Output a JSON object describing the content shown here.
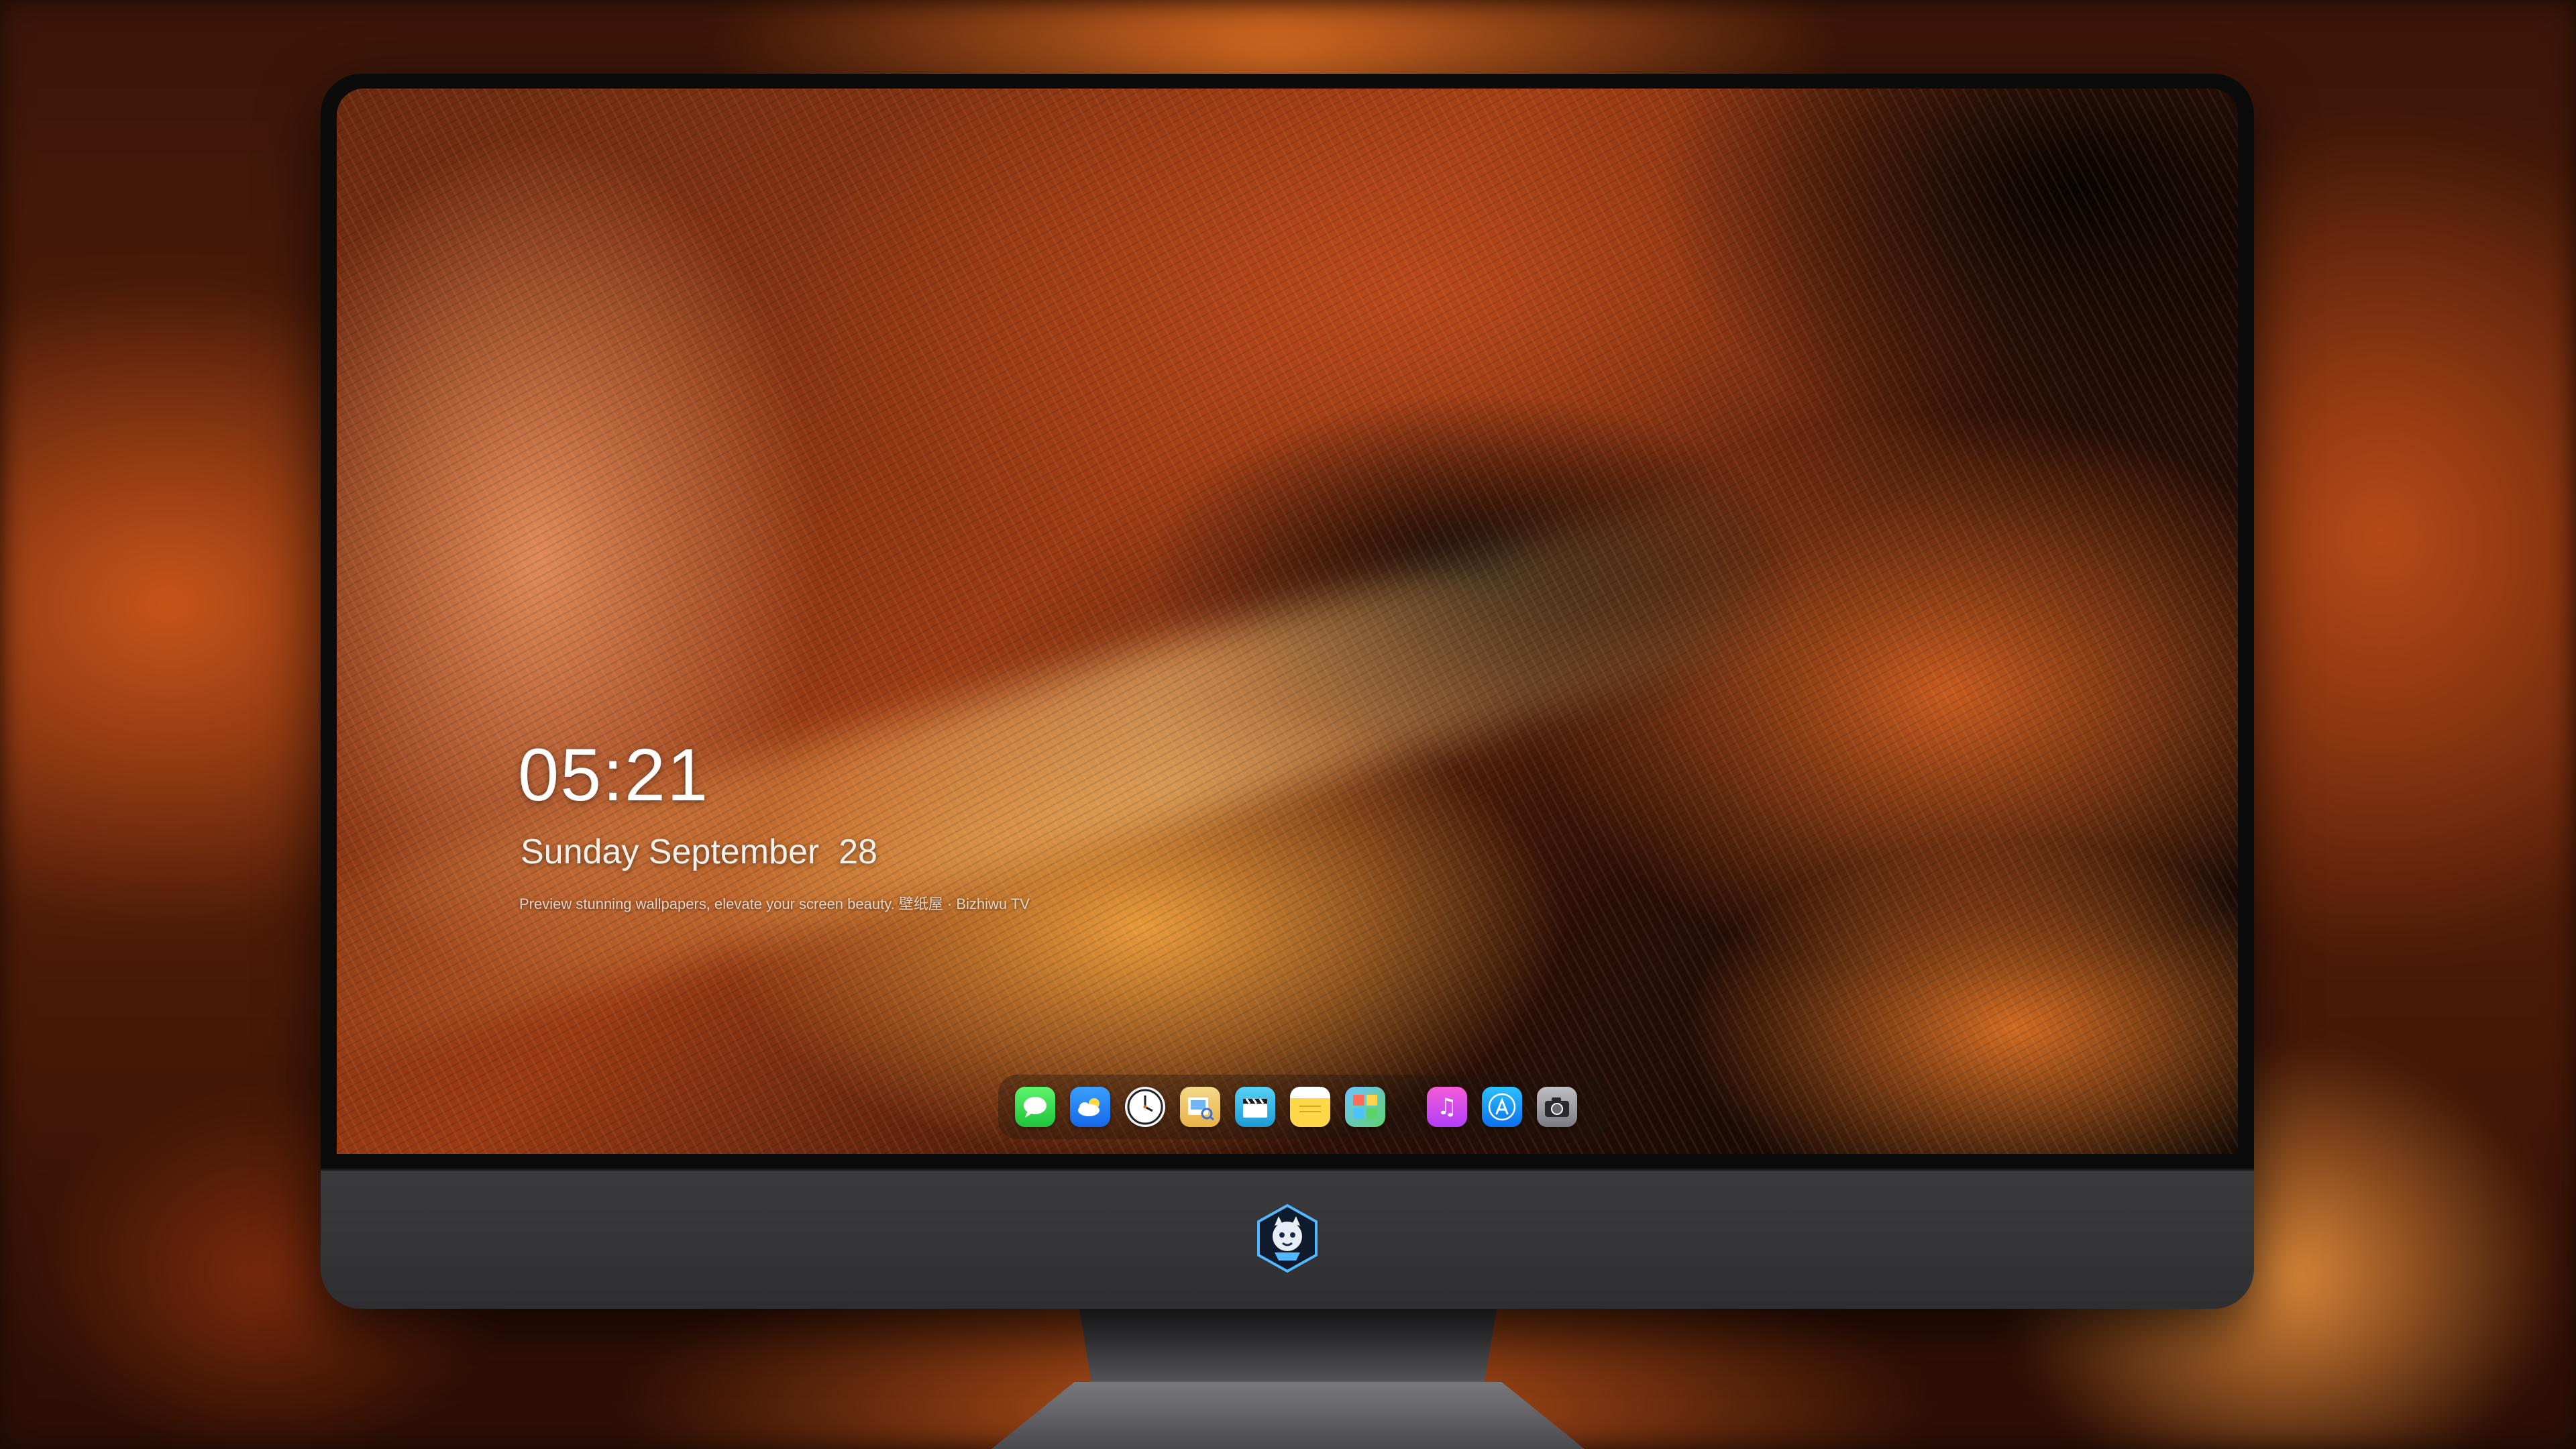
{
  "lock_screen": {
    "time": "05:21",
    "date": "Sunday September  28",
    "tagline": "Preview stunning wallpapers, elevate your screen beauty. 壁纸屋 · Bizhiwu TV"
  },
  "dock": {
    "apps": [
      {
        "name": "Messages",
        "icon": "message-bubble-icon"
      },
      {
        "name": "Weather",
        "icon": "cloud-sun-icon"
      },
      {
        "name": "Clock",
        "icon": "clock-icon"
      },
      {
        "name": "Preview",
        "icon": "preview-icon"
      },
      {
        "name": "Clips",
        "icon": "clapperboard-icon"
      },
      {
        "name": "Notes",
        "icon": "notes-icon"
      },
      {
        "name": "Photos",
        "icon": "photo-grid-icon"
      },
      {
        "name": "Music",
        "icon": "music-note-icon"
      },
      {
        "name": "App Store",
        "icon": "app-store-icon"
      },
      {
        "name": "Camera",
        "icon": "camera-icon"
      }
    ]
  },
  "colors": {
    "accent": "#e0712a",
    "bezel": "#0b0b0c",
    "chin": "#38373a"
  }
}
